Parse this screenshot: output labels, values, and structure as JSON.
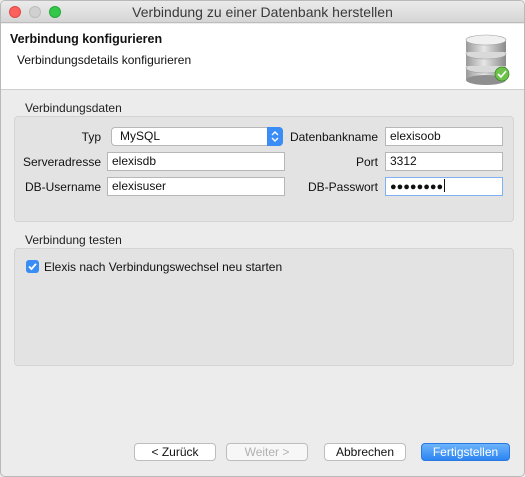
{
  "window": {
    "title": "Verbindung zu einer Datenbank herstellen"
  },
  "header": {
    "title": "Verbindung konfigurieren",
    "subtitle": "Verbindungsdetails konfigurieren",
    "icon": "database-icon"
  },
  "connection": {
    "group_label": "Verbindungsdaten",
    "type_label": "Typ",
    "type_value": "MySQL",
    "dbname_label": "Datenbankname",
    "dbname_value": "elexisoob",
    "server_label": "Serveradresse",
    "server_value": "elexisdb",
    "port_label": "Port",
    "port_value": "3312",
    "username_label": "DB-Username",
    "username_value": "elexisuser",
    "password_label": "DB-Passwort",
    "password_value": "●●●●●●●●"
  },
  "test": {
    "group_label": "Verbindung testen",
    "restart_label": "Elexis nach Verbindungswechsel neu starten",
    "restart_checked": true
  },
  "buttons": {
    "back": "< Zurück",
    "next": "Weiter >",
    "cancel": "Abbrechen",
    "finish": "Fertigstellen"
  },
  "colors": {
    "accent": "#3b8df6",
    "close": "#fc605c",
    "maximize": "#34c84a"
  }
}
